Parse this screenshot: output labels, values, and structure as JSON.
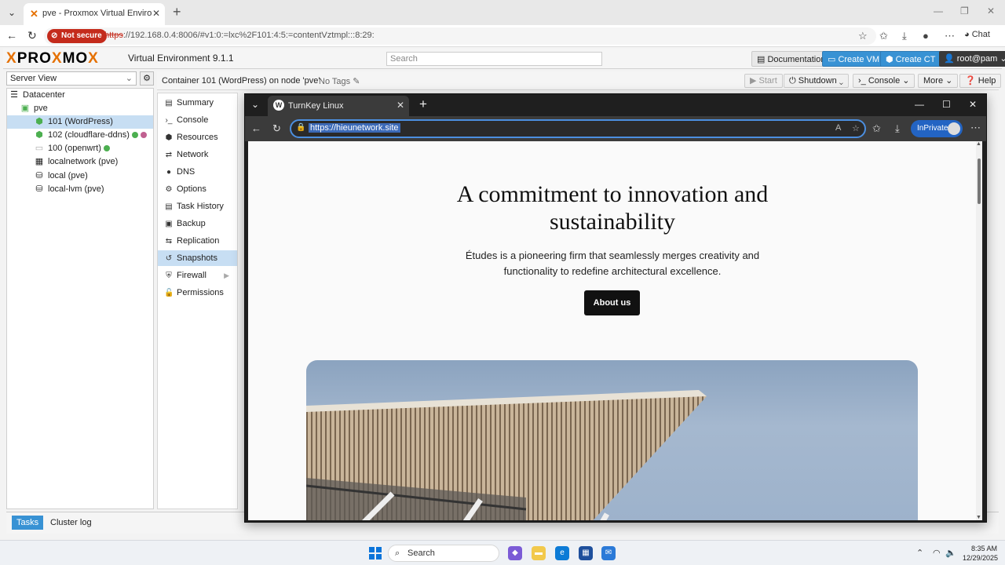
{
  "browser": {
    "tab_title": "pve - Proxmox Virtual Environment",
    "url_prefix": "https",
    "url_rest": "://192.168.0.4:8006/#v1:0:=lxc%2F101:4:5:=contentVztmpl:::8:29:",
    "not_secure_label": "Not secure",
    "chat_label": "Chat"
  },
  "pve": {
    "logo_left": "PRO",
    "logo_x": "X",
    "logo_mid": "MO",
    "logo_right": "X",
    "version": "Virtual Environment 9.1.1",
    "search_placeholder": "Search",
    "documentation": "Documentation",
    "create_vm": "Create VM",
    "create_ct": "Create CT",
    "user": "root@pam"
  },
  "tree": {
    "view": "Server View",
    "nodes": [
      {
        "label": "Datacenter"
      },
      {
        "label": "pve"
      },
      {
        "label": "101 (WordPress)"
      },
      {
        "label": "102 (cloudflare-ddns)"
      },
      {
        "label": "100 (openwrt)"
      },
      {
        "label": "localnetwork (pve)"
      },
      {
        "label": "local (pve)"
      },
      {
        "label": "local-lvm (pve)"
      }
    ]
  },
  "container": {
    "title": "Container 101 (WordPress) on node 'pve'",
    "tags": "No Tags",
    "start": "Start",
    "shutdown": "Shutdown",
    "console": "Console",
    "more": "More",
    "help": "Help"
  },
  "menu": {
    "items": [
      {
        "label": "Summary"
      },
      {
        "label": "Console"
      },
      {
        "label": "Resources"
      },
      {
        "label": "Network"
      },
      {
        "label": "DNS"
      },
      {
        "label": "Options"
      },
      {
        "label": "Task History"
      },
      {
        "label": "Backup"
      },
      {
        "label": "Replication"
      },
      {
        "label": "Snapshots"
      },
      {
        "label": "Firewall"
      },
      {
        "label": "Permissions"
      }
    ]
  },
  "bottom": {
    "tasks": "Tasks",
    "cluster_log": "Cluster log"
  },
  "inner_browser": {
    "tab_title": "TurnKey Linux",
    "url": "https://hieunetwork.site",
    "inprivate": "InPrivate"
  },
  "site": {
    "title_line1": "A commitment to innovation and",
    "title_line2": "sustainability",
    "sub_line1": "Études is a pioneering firm that seamlessly merges creativity and",
    "sub_line2": "functionality to redefine architectural excellence.",
    "about_btn": "About us"
  },
  "taskbar": {
    "search": "Search",
    "time": "8:35 AM",
    "date": "12/29/2025"
  },
  "colors": {
    "accent_blue": "#3892d4",
    "proxmox_orange": "#e57000",
    "status_green": "#4caf50",
    "status_pink": "#c06090"
  }
}
